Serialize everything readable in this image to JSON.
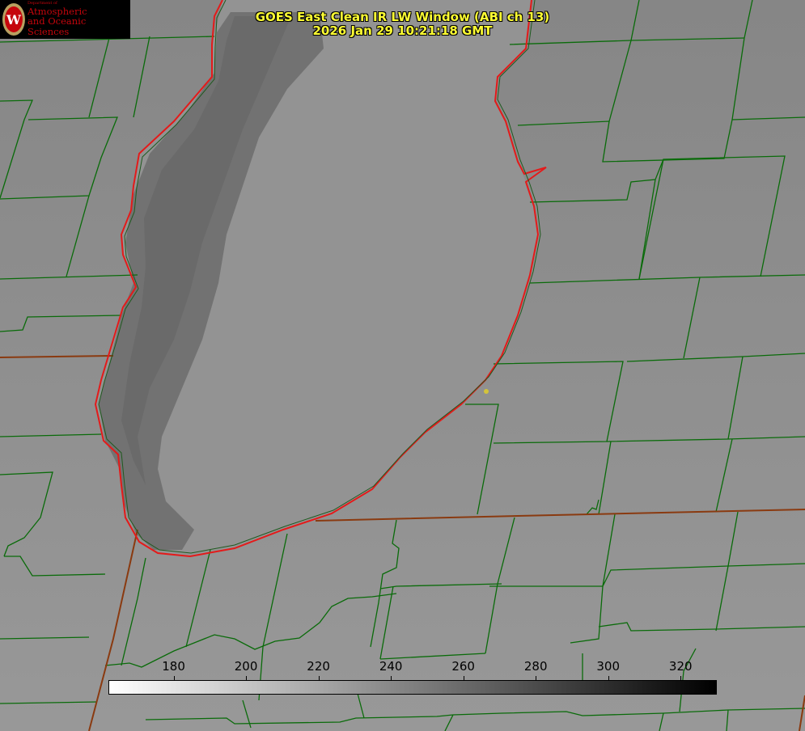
{
  "title": {
    "line1": "GOES East Clean IR LW Window (ABI ch 13)",
    "line2": "2026 Jan 29 10:21:18 GMT"
  },
  "logo": {
    "dept": "Department of",
    "line1": "Atmospheric",
    "line2": "and Oceanic Sciences",
    "seal_letter": "W"
  },
  "colorbar": {
    "ticks": [
      "180",
      "200",
      "220",
      "240",
      "260",
      "280",
      "300",
      "320"
    ],
    "tick_values": [
      180,
      200,
      220,
      240,
      260,
      280,
      300,
      320
    ],
    "range": [
      162,
      330
    ],
    "start_color": "#ffffff",
    "end_color": "#000000"
  },
  "colors": {
    "background": "#8f8f8f",
    "lake": "#939393",
    "cold_band": "#6f6f6f",
    "county_lines": "#0a6b0a",
    "state_lines": "#8a3a10",
    "shoreline": "#e41a1a",
    "title_text": "#ffff33",
    "logo_red": "#c5050c"
  },
  "marker": {
    "icon": "yellow-dot-icon",
    "color": "#d4c43a"
  }
}
